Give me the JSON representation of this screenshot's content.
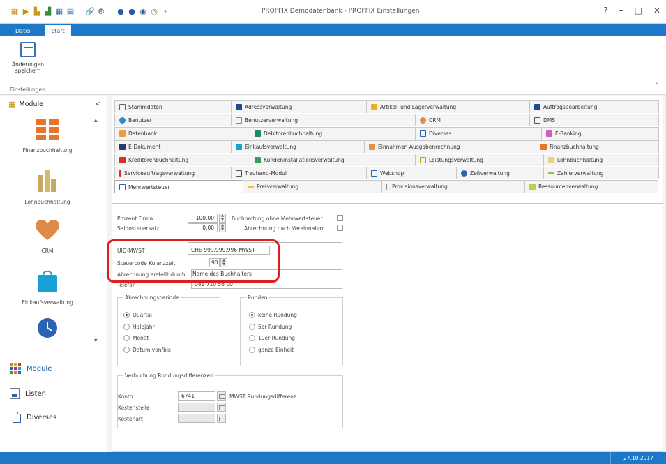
{
  "window": {
    "title": "PROFFIX Demodatenbank - PROFFIX Einstellungen",
    "controls": {
      "help": "?",
      "minimize": "–",
      "maximize": "□",
      "close": "✕"
    }
  },
  "ribbon": {
    "tabs": {
      "file": "Datei",
      "start": "Start"
    },
    "save_button": {
      "line1": "Änderungen",
      "line2": "speichern"
    },
    "group_label": "Einstellungen",
    "collapse": "^"
  },
  "nav": {
    "header": "Module",
    "collapse": "<",
    "modules": [
      "Finanzbuchhaltung",
      "Lohnbuchhaltung",
      "CRM",
      "Einkaufsverwaltung"
    ],
    "bottom_buttons": [
      "Module",
      "Listen",
      "Diverses"
    ]
  },
  "tabs": {
    "row1": [
      "Stammdaten",
      "Adressverwaltung",
      "Artikel- und Lagerverwaltung",
      "Auftragsbearbeitung"
    ],
    "row2": [
      "Benutzer",
      "Benutzerverwaltung",
      "CRM",
      "DMS"
    ],
    "row3": [
      "Datenbank",
      "Debitorenbuchhaltung",
      "Diverses",
      "E-Banking"
    ],
    "row4": [
      "E-Dokument",
      "Einkaufsverwaltung",
      "Einnahmen-Ausgabenrechnung",
      "Finanzbuchhaltung"
    ],
    "row5": [
      "Kreditorenbuchhaltung",
      "Kundeninstallationsverwaltung",
      "Leistungsverwaltung",
      "Lohnbuchhaltung"
    ],
    "row6": [
      "Serviceauftragsverwaltung",
      "Treuhand-Modul",
      "Webshop",
      "Zeitverwaltung",
      "Zahlerverwaltung"
    ],
    "row7": [
      "Mehrwertsteuer",
      "Preisverwaltung",
      "Provisionsverwaltung",
      "Ressourcenverwaltung"
    ]
  },
  "form": {
    "prozent_firma": {
      "label": "Prozent Firma",
      "value": "100.00"
    },
    "saldosteuersatz": {
      "label": "Saldosteuersatz",
      "value": "0.00"
    },
    "ohne_mwst": {
      "label": "Buchhaltung ohne Mehrwertsteuer"
    },
    "vereinnahmt": {
      "label": "Abrechnung nach Vereinnahmt"
    },
    "uid_mwst": {
      "label": "UID-MWST",
      "value": "CHE-999.999.996 MWST"
    },
    "steuercode": {
      "label": "Steuercode Kulanzzeit",
      "value": "90"
    },
    "abrechnung_durch": {
      "label": "Abrechnung erstellt durch",
      "value": "Name des Buchhalters"
    },
    "telefon": {
      "label": "Telefon",
      "value": "081 710 56 00"
    }
  },
  "abrechnungsperiode": {
    "title": "Abrechnungsperiode",
    "options": [
      "Quartal",
      "Halbjahr",
      "Monat",
      "Datum von/bis"
    ],
    "selected": 0
  },
  "runden": {
    "title": "Runden",
    "options": [
      "keine Rundung",
      "5er Rundung",
      "10er Rundung",
      "ganze Einheit"
    ],
    "selected": 0
  },
  "verbuchung": {
    "title": "Verbuchung Rundungsdifferenzen",
    "konto": {
      "label": "Konto",
      "value": "6741",
      "desc": "MWST Rundungsdifferenz"
    },
    "kostenstelle": {
      "label": "Kostenstelle"
    },
    "kostenart": {
      "label": "Kostenart"
    }
  },
  "status": {
    "date": "27.10.2017"
  },
  "colors": {
    "accent": "#1e78c8",
    "highlight": "#e01e1e"
  }
}
